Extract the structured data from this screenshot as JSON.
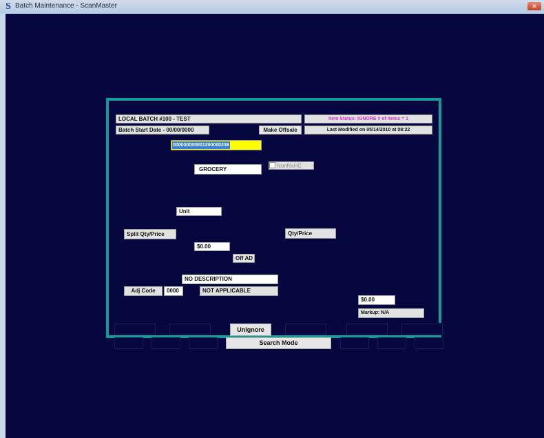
{
  "window": {
    "title": "Batch Maintenance - ScanMaster",
    "icon": "s-logo-icon"
  },
  "form": {
    "batch_title": "LOCAL BATCH #100 - TEST",
    "item_status": "Item Status: IGNORE  # of Items = 1",
    "batch_start": "Batch Start Date - 00/00/0000",
    "make_offsale": "Make Offsale",
    "last_modified": "Last Modified on 05/14/2010 at 08:22",
    "upc": "000000000001200000236",
    "department": "GROCERY",
    "nonrxhc_label": "NonRxHC",
    "unit_label": "Unit",
    "split_qty_label": "Split Qty/Price",
    "qty_price_label": "Qty/Price",
    "price_value": "$0.00",
    "off_ad_label": "Off AD",
    "description": "NO DESCRIPTION",
    "adj_code_label": "Adj Code",
    "adj_code_value": "0000",
    "adj_code_desc": "NOT APPLICABLE",
    "right_price": "$0.00",
    "markup": "Markup:  N/A"
  },
  "footer": {
    "unignore_label": "UnIgnore",
    "search_mode_label": "Search Mode"
  },
  "colors": {
    "background": "#05073e",
    "frame": "#149b98",
    "highlight": "#ffff00",
    "status_text": "#d233c6"
  }
}
